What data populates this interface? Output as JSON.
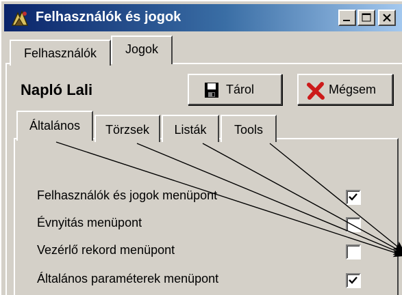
{
  "window": {
    "title": "Felhasználók és jogok",
    "controls": {
      "minimize": "minimize-icon",
      "maximize": "maximize-icon",
      "close": "close-icon"
    }
  },
  "outer_tabs": [
    {
      "label": "Felhasználók",
      "active": false
    },
    {
      "label": "Jogok",
      "active": true
    }
  ],
  "user_name": "Napló Lali",
  "buttons": {
    "save": {
      "label": "Tárol",
      "icon": "floppy-disk-icon"
    },
    "cancel": {
      "label": "Mégsem",
      "icon": "red-x-icon"
    }
  },
  "inner_tabs": [
    {
      "label": "Általános",
      "active": true
    },
    {
      "label": "Törzsek",
      "active": false
    },
    {
      "label": "Listák",
      "active": false
    },
    {
      "label": "Tools",
      "active": false
    }
  ],
  "permissions": [
    {
      "label": "Felhasználók és jogok menüpont",
      "checked": true
    },
    {
      "label": "Évnyitás menüpont",
      "checked": false
    },
    {
      "label": "Vezérlő rekord menüpont",
      "checked": false
    },
    {
      "label": "Általános paraméterek menüpont",
      "checked": true
    }
  ],
  "colors": {
    "titlebar_start": "#0a246a",
    "titlebar_end": "#a6caf0",
    "face": "#d4d0c8",
    "cancel_x": "#cc1a1a"
  }
}
